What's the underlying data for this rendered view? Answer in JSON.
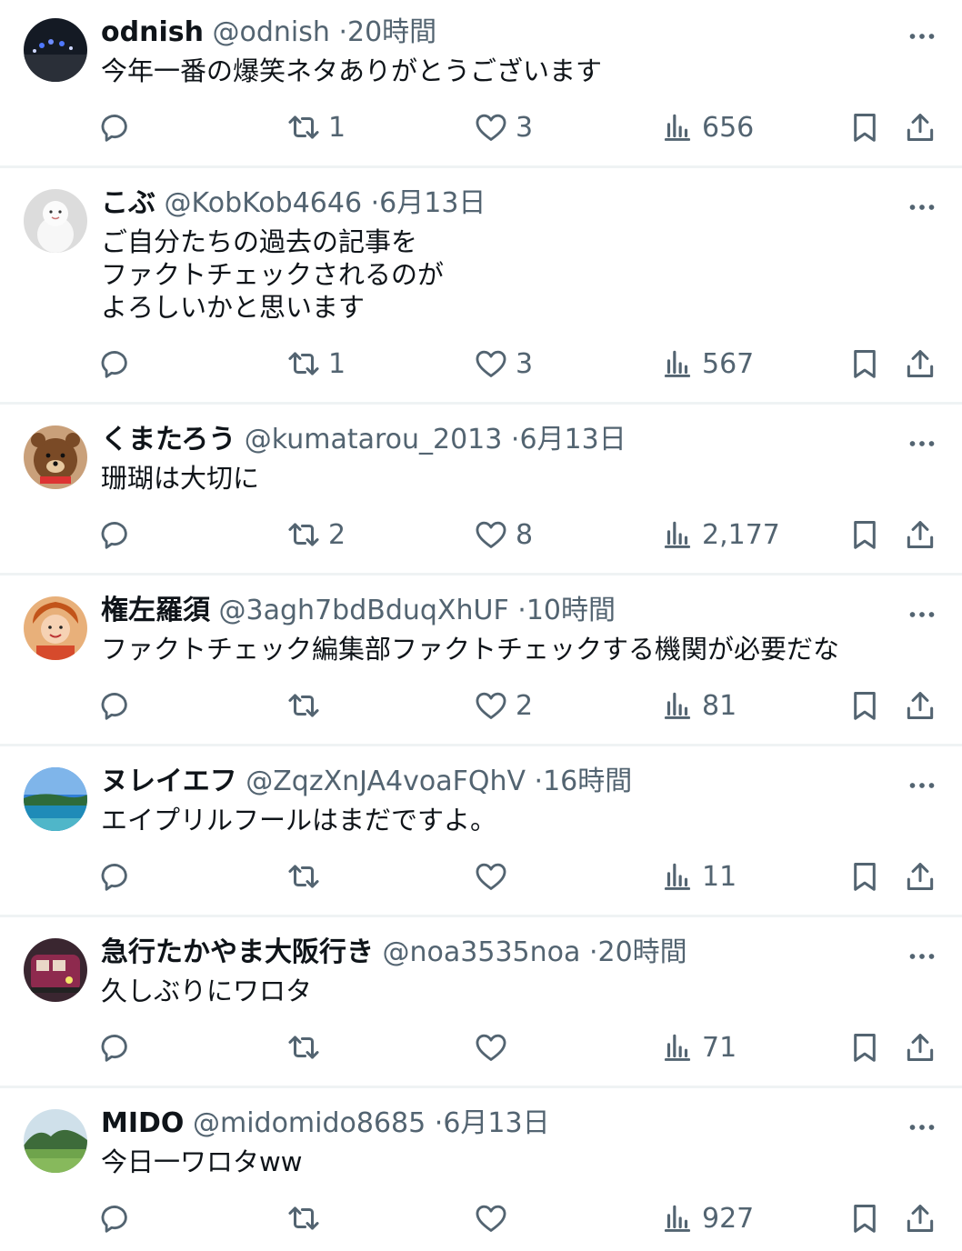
{
  "tweets": [
    {
      "name": "odnish",
      "handle": "@odnish",
      "sep": "·",
      "time": "20時間",
      "text": "今年一番の爆笑ネタありがとうございます",
      "retweets": "1",
      "likes": "3",
      "views": "656"
    },
    {
      "name": "こぶ",
      "handle": "@KobKob4646",
      "sep": "·",
      "time": "6月13日",
      "text": "ご自分たちの過去の記事を\nファクトチェックされるのが\nよろしいかと思います",
      "retweets": "1",
      "likes": "3",
      "views": "567"
    },
    {
      "name": "くまたろう",
      "handle": "@kumatarou_2013",
      "sep": "·",
      "time": "6月13日",
      "text": "珊瑚は大切に",
      "retweets": "2",
      "likes": "8",
      "views": "2,177"
    },
    {
      "name": "権左羅須",
      "handle": "@3agh7bdBduqXhUF",
      "sep": "·",
      "time": "10時間",
      "text": "ファクトチェック編集部ファクトチェックする機関が必要だな",
      "retweets": "",
      "likes": "2",
      "views": "81"
    },
    {
      "name": "ヌレイエフ",
      "handle": "@ZqzXnJA4voaFQhV",
      "sep": "·",
      "time": "16時間",
      "text": "エイプリルフールはまだですよ。",
      "retweets": "",
      "likes": "",
      "views": "11"
    },
    {
      "name": "急行たかやま大阪行き",
      "handle": "@noa3535noa",
      "sep": "·",
      "time": "20時間",
      "text": "久しぶりにワロタ",
      "retweets": "",
      "likes": "",
      "views": "71"
    },
    {
      "name": "MIDO",
      "handle": "@midomido8685",
      "sep": "·",
      "time": "6月13日",
      "text": "今日一ワロタww",
      "retweets": "",
      "likes": "",
      "views": "927"
    }
  ],
  "icons": {
    "reply": "reply-icon",
    "retweet": "retweet-icon",
    "like": "heart-icon",
    "views": "views-icon",
    "bookmark": "bookmark-icon",
    "share": "share-icon",
    "more": "more-icon"
  },
  "colors": {
    "text": "#0f1419",
    "secondary": "#536471",
    "divider": "#eff3f4"
  }
}
